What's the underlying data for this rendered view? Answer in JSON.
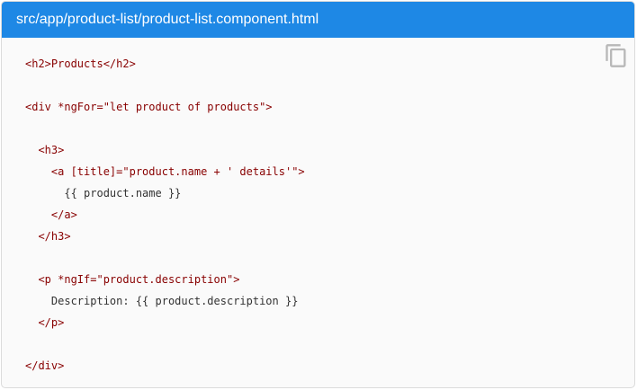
{
  "header": {
    "file_path": "src/app/product-list/product-list.component.html"
  },
  "copy_button": {
    "icon": "copy-icon"
  },
  "code": {
    "lines": [
      "<h2>Products</h2>",
      "",
      "<div *ngFor=\"let product of products\">",
      "",
      "  <h3>",
      "    <a [title]=\"product.name + ' details'\">",
      "      {{ product.name }}",
      "    </a>",
      "  </h3>",
      "",
      "  <p *ngIf=\"product.description\">",
      "    Description: {{ product.description }}",
      "  </p>",
      "",
      "</div>"
    ]
  },
  "colors": {
    "header_bg": "#1e88e5",
    "tag": "#880000",
    "text": "#333333"
  }
}
